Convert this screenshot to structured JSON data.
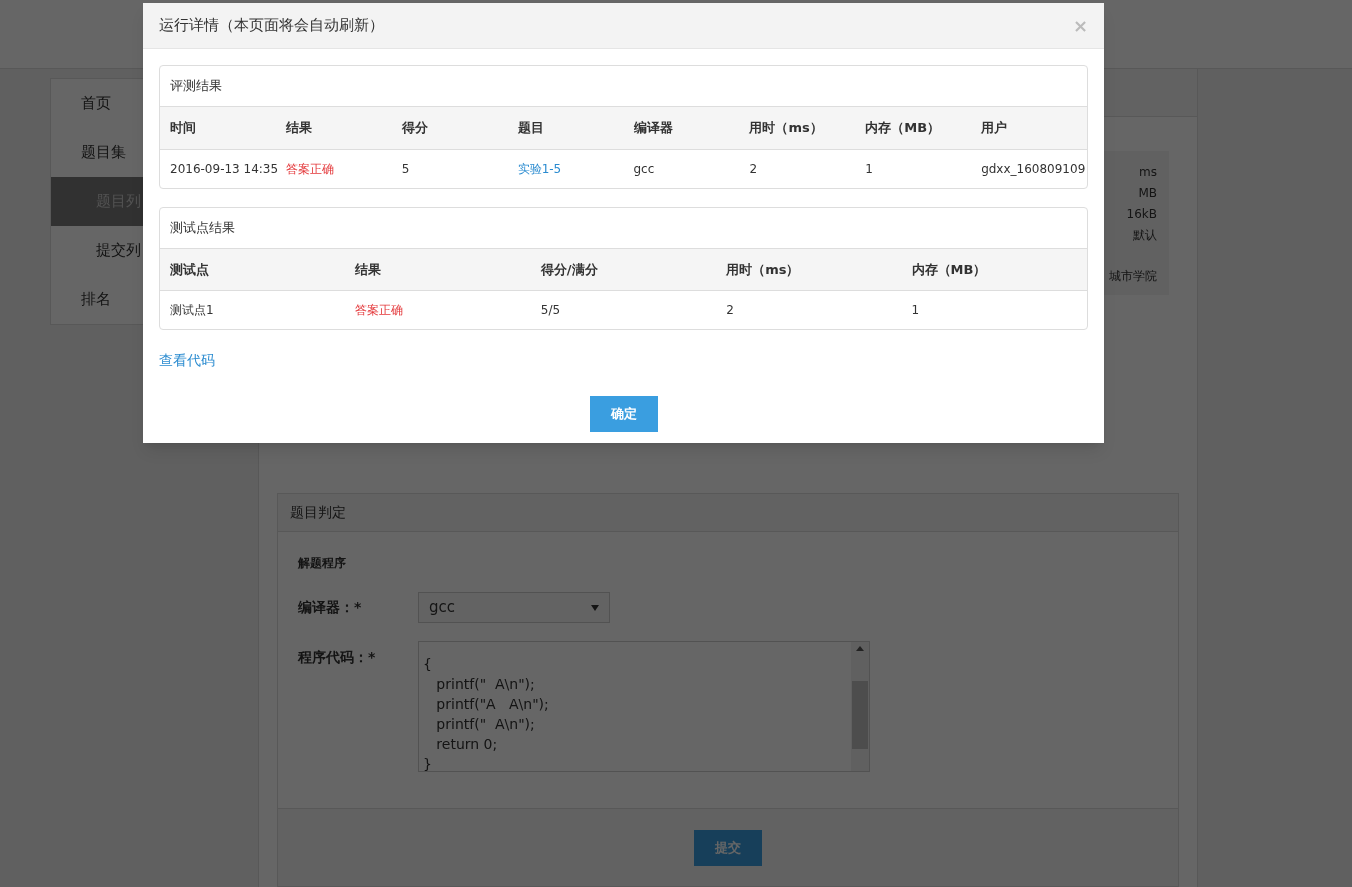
{
  "sidebar": {
    "items": [
      {
        "label": "首页",
        "selected": false,
        "sub": false
      },
      {
        "label": "题目集",
        "selected": false,
        "sub": false
      },
      {
        "label": "题目列",
        "selected": true,
        "sub": true
      },
      {
        "label": "提交列",
        "selected": false,
        "sub": true
      },
      {
        "label": "排名",
        "selected": false,
        "sub": false
      }
    ]
  },
  "info_box": {
    "lines": [
      "ms",
      "MB",
      "16kB",
      "默认",
      "城市学院"
    ]
  },
  "judge_panel": {
    "title": "题目判定",
    "section": "解题程序",
    "compiler_label": "编译器：*",
    "compiler_value": "gcc",
    "code_label": "程序代码：*",
    "code_lines": [
      "{",
      "   printf(\"  A\\n\");",
      "   printf(\"A   A\\n\");",
      "   printf(\"  A\\n\");",
      "   return 0;",
      "}"
    ],
    "submit": "提交"
  },
  "modal": {
    "title": "运行详情（本页面将会自动刷新）",
    "close": "×",
    "judge_result": {
      "title": "评测结果",
      "columns": [
        "时间",
        "结果",
        "得分",
        "题目",
        "编译器",
        "用时（ms）",
        "内存（MB）",
        "用户"
      ],
      "rows": [
        [
          {
            "text": "2016-09-13 14:35",
            "kind": "text"
          },
          {
            "text": "答案正确",
            "kind": "status"
          },
          {
            "text": "5",
            "kind": "text"
          },
          {
            "text": "实验1-5",
            "kind": "link"
          },
          {
            "text": "gcc",
            "kind": "text"
          },
          {
            "text": "2",
            "kind": "text"
          },
          {
            "text": "1",
            "kind": "text"
          },
          {
            "text": "gdxx_160809109",
            "kind": "text"
          }
        ]
      ]
    },
    "test_result": {
      "title": "测试点结果",
      "columns": [
        "测试点",
        "结果",
        "得分/满分",
        "用时（ms）",
        "内存（MB）"
      ],
      "rows": [
        [
          {
            "text": "测试点1",
            "kind": "text"
          },
          {
            "text": "答案正确",
            "kind": "status"
          },
          {
            "text": "5/5",
            "kind": "text"
          },
          {
            "text": "2",
            "kind": "text"
          },
          {
            "text": "1",
            "kind": "text"
          }
        ]
      ]
    },
    "view_code": "查看代码",
    "ok": "确定"
  }
}
